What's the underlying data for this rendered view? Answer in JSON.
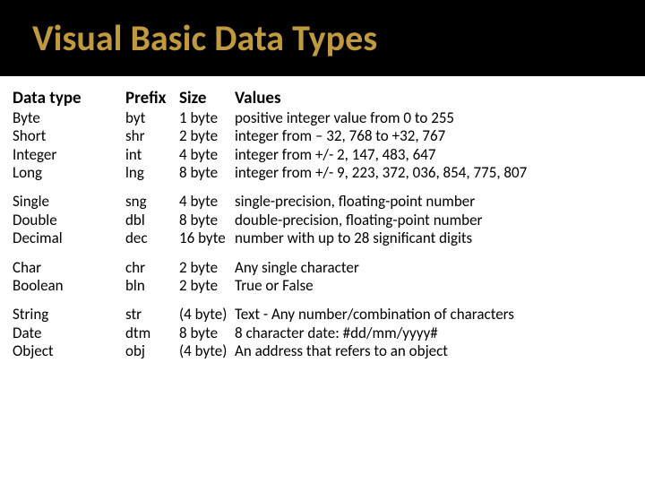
{
  "title": "Visual Basic Data Types",
  "headers": {
    "type": "Data type",
    "prefix": "Prefix",
    "size": "Size",
    "values": "Values"
  },
  "groups": [
    [
      {
        "type": "Byte",
        "prefix": "byt",
        "size": "1 byte",
        "values": "positive integer value from 0 to 255"
      },
      {
        "type": "Short",
        "prefix": "shr",
        "size": "2 byte",
        "values": "integer from – 32, 768 to +32, 767"
      },
      {
        "type": "Integer",
        "prefix": "int",
        "size": "4 byte",
        "values": "integer from +/- 2, 147, 483, 647"
      },
      {
        "type": "Long",
        "prefix": "lng",
        "size": "8 byte",
        "values": "integer from +/- 9, 223, 372, 036, 854, 775, 807"
      }
    ],
    [
      {
        "type": "Single",
        "prefix": "sng",
        "size": "4 byte",
        "values": "single-precision, floating-point number"
      },
      {
        "type": "Double",
        "prefix": "dbl",
        "size": "8 byte",
        "values": "double-precision, floating-point number"
      },
      {
        "type": "Decimal",
        "prefix": "dec",
        "size": "16 byte",
        "values": "number with up to 28 significant digits"
      }
    ],
    [
      {
        "type": "Char",
        "prefix": "chr",
        "size": "2 byte",
        "values": "Any single character"
      },
      {
        "type": "Boolean",
        "prefix": "bln",
        "size": "2 byte",
        "values": "True or False"
      }
    ],
    [
      {
        "type": "String",
        "prefix": "str",
        "size": "(4 byte)",
        "values": "Text - Any number/combination of characters"
      },
      {
        "type": "Date",
        "prefix": "dtm",
        "size": "8 byte",
        "values": "8 character date:  #dd/mm/yyyy#"
      },
      {
        "type": "Object",
        "prefix": "obj",
        "size": "(4 byte)",
        "values": "An address that refers to an object"
      }
    ]
  ]
}
